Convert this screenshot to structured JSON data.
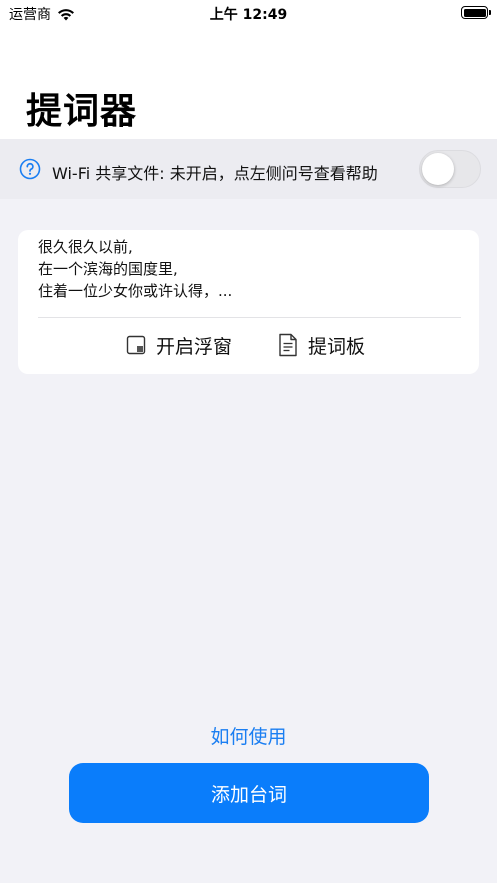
{
  "status_bar": {
    "carrier": "运营商",
    "time": "上午 12:49"
  },
  "page": {
    "title": "提词器"
  },
  "wifi_share": {
    "text": "Wi-Fi 共享文件: 未开启，点左侧问号查看帮助",
    "enabled": false,
    "help_icon": "question-circle-icon"
  },
  "script_card": {
    "lines": [
      "很久很久以前,",
      "在一个滨海的国度里,",
      "住着一位少女你或许认得，..."
    ],
    "actions": {
      "float_window_label": "开启浮窗",
      "prompter_board_label": "提词板"
    }
  },
  "footer": {
    "how_to_label": "如何使用",
    "add_button_label": "添加台词"
  },
  "colors": {
    "accent": "#0a7dfb",
    "link": "#1a7ef2",
    "background": "#f2f2f7"
  }
}
